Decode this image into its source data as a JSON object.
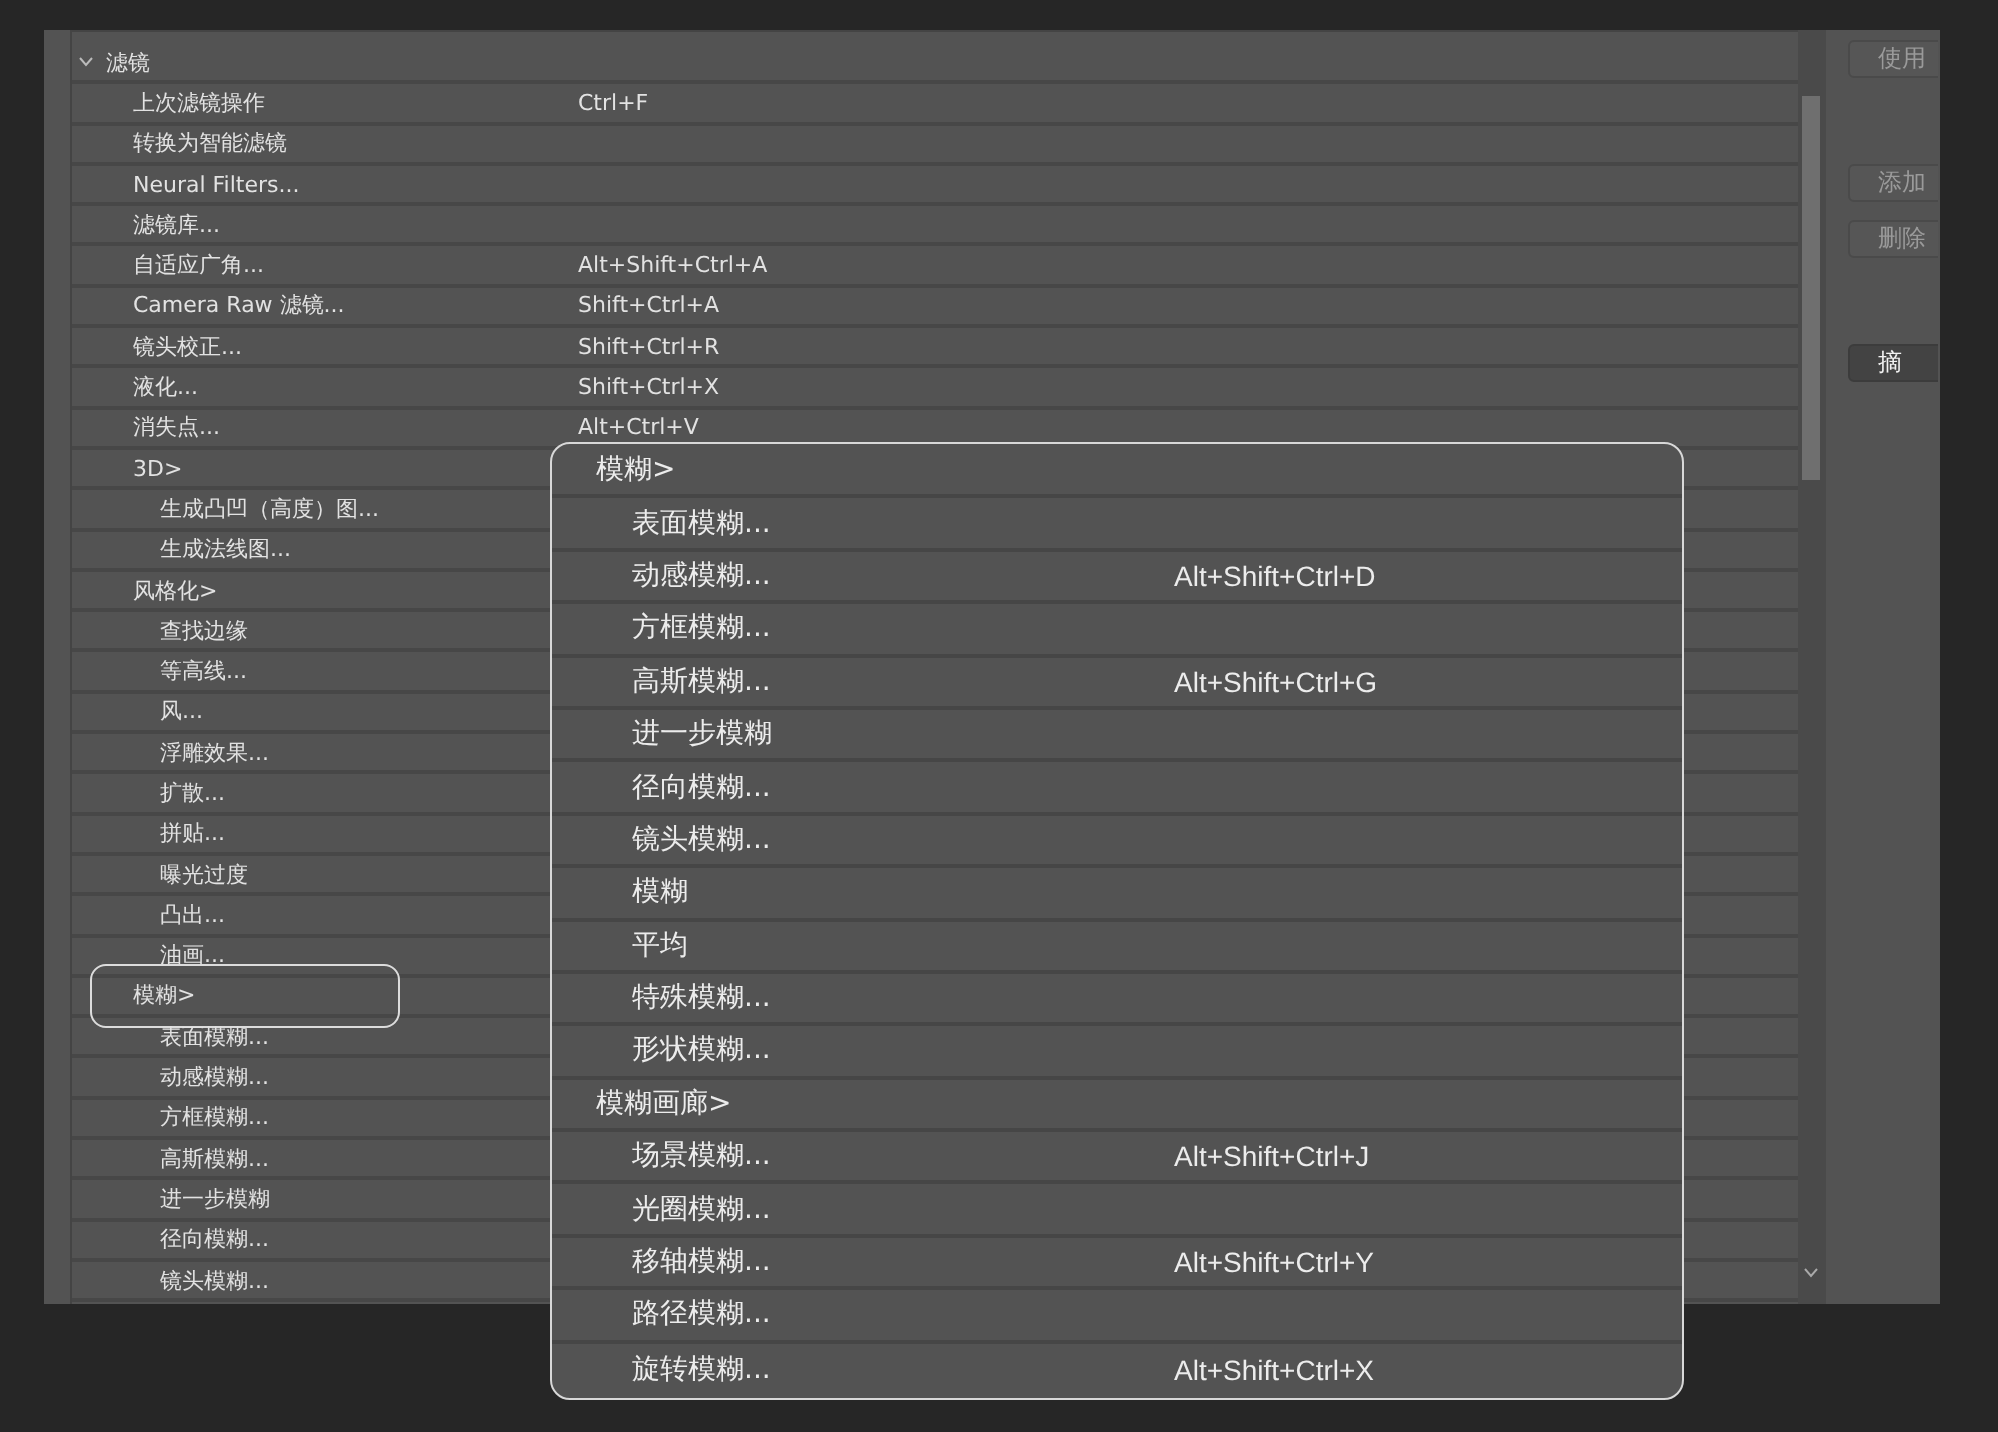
{
  "shortcut_list": {
    "items": [
      {
        "label": "滤镜",
        "expanded": true,
        "children": [
          {
            "label": "上次滤镜操作",
            "shortcut": "Ctrl+F",
            "highlighted": false
          },
          {
            "label": "转换为智能滤镜",
            "highlighted": false
          },
          {
            "label": "Neural Filters...",
            "highlighted": false
          },
          {
            "label": "滤镜库...",
            "highlighted": false
          },
          {
            "label": "自适应广角...",
            "shortcut": "Alt+Shift+Ctrl+A",
            "highlighted": false
          },
          {
            "label": "Camera Raw 滤镜...",
            "shortcut": "Shift+Ctrl+A",
            "highlighted": false
          },
          {
            "label": "镜头校正...",
            "shortcut": "Shift+Ctrl+R",
            "highlighted": false
          },
          {
            "label": "液化...",
            "shortcut": "Shift+Ctrl+X",
            "highlighted": false
          },
          {
            "label": "消失点...",
            "shortcut": "Alt+Ctrl+V",
            "highlighted": false
          },
          {
            "label": "3D>",
            "highlighted": false,
            "children": [
              {
                "label": "生成凸凹（高度）图..."
              },
              {
                "label": "生成法线图..."
              }
            ]
          },
          {
            "label": "风格化>",
            "highlighted": false,
            "children": [
              {
                "label": "查找边缘"
              },
              {
                "label": "等高线..."
              },
              {
                "label": "风..."
              },
              {
                "label": "浮雕效果..."
              },
              {
                "label": "扩散..."
              },
              {
                "label": "拼贴..."
              },
              {
                "label": "曝光过度"
              },
              {
                "label": "凸出..."
              },
              {
                "label": "油画..."
              }
            ]
          },
          {
            "label": "模糊>",
            "highlighted": true,
            "children": [
              {
                "label": "表面模糊..."
              },
              {
                "label": "动感模糊..."
              },
              {
                "label": "方框模糊..."
              },
              {
                "label": "高斯模糊..."
              },
              {
                "label": "进一步模糊"
              },
              {
                "label": "径向模糊..."
              },
              {
                "label": "镜头模糊..."
              }
            ]
          }
        ]
      }
    ]
  },
  "side_buttons": [
    {
      "label": "使用",
      "disabled": true
    },
    {
      "label": "添加",
      "disabled": true
    },
    {
      "label": "删除",
      "disabled": true
    },
    {
      "label": "摘",
      "disabled": false
    }
  ],
  "popup": {
    "items": [
      {
        "label": "模糊>",
        "children": [
          {
            "label": "表面模糊..."
          },
          {
            "label": "动感模糊...",
            "shortcut": "Alt+Shift+Ctrl+D"
          },
          {
            "label": "方框模糊..."
          },
          {
            "label": "高斯模糊...",
            "shortcut": "Alt+Shift+Ctrl+G"
          },
          {
            "label": "进一步模糊"
          },
          {
            "label": "径向模糊..."
          },
          {
            "label": "镜头模糊..."
          },
          {
            "label": "模糊"
          },
          {
            "label": "平均"
          },
          {
            "label": "特殊模糊..."
          },
          {
            "label": "形状模糊..."
          }
        ]
      },
      {
        "label": "模糊画廊>",
        "children": [
          {
            "label": "场景模糊...",
            "shortcut": "Alt+Shift+Ctrl+J"
          },
          {
            "label": "光圈模糊..."
          },
          {
            "label": "移轴模糊...",
            "shortcut": "Alt+Shift+Ctrl+Y"
          },
          {
            "label": "路径模糊..."
          },
          {
            "label": "旋转模糊...",
            "shortcut": "Alt+Shift+Ctrl+X"
          }
        ]
      }
    ]
  }
}
